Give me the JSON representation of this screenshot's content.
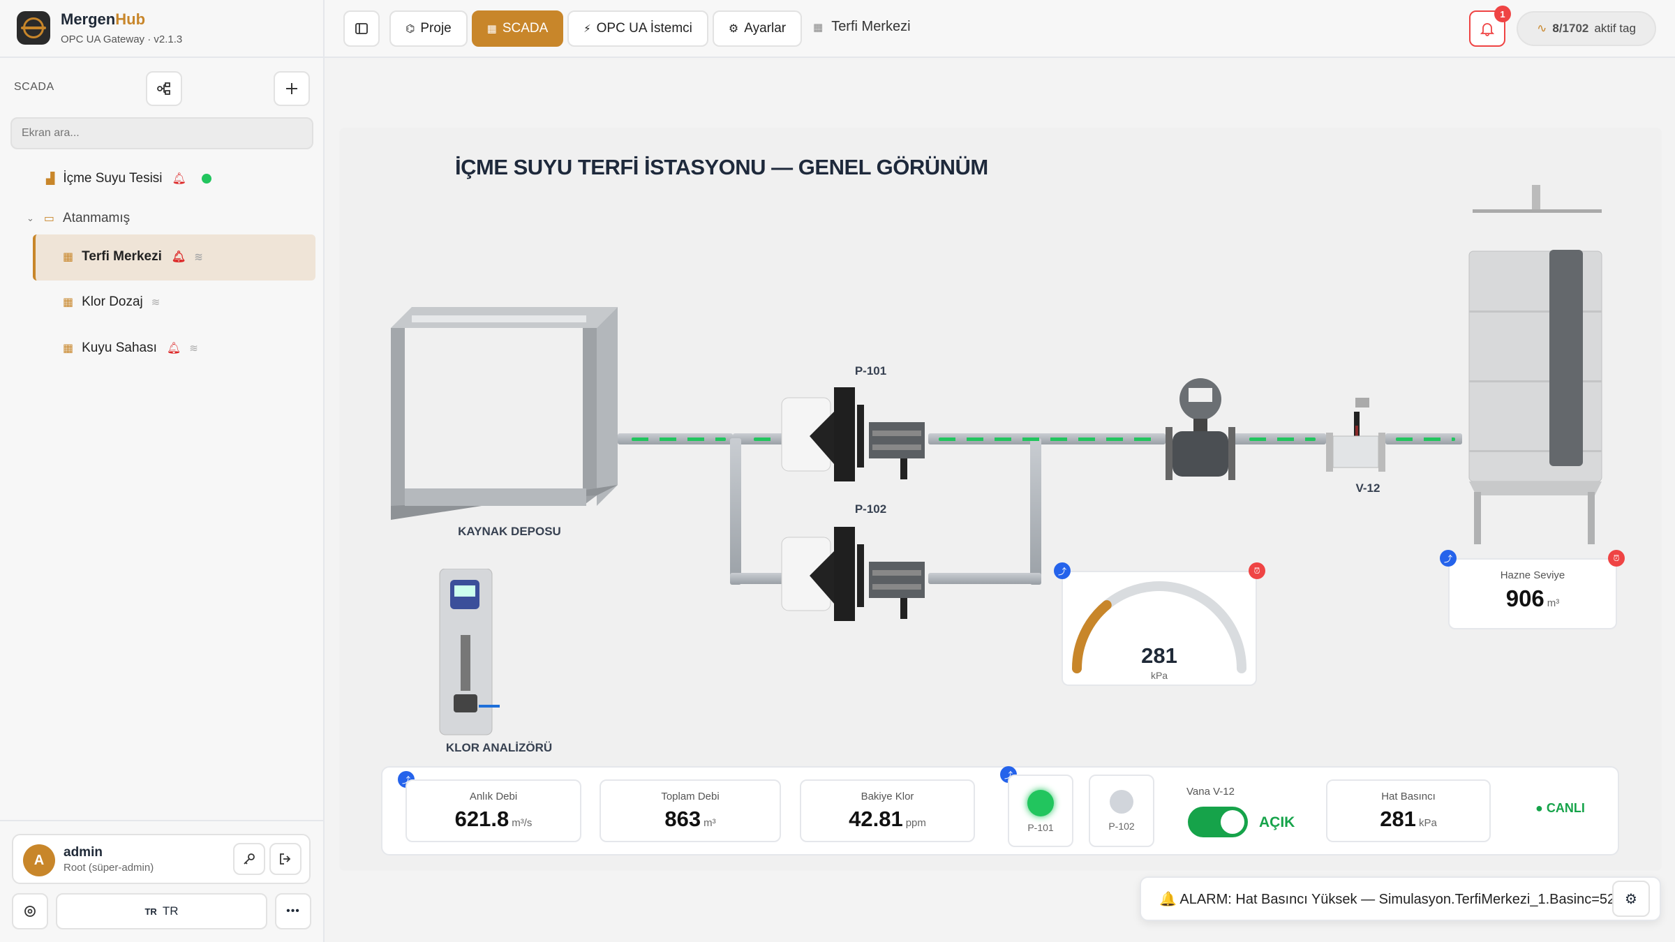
{
  "brand": {
    "name_main": "Mergen",
    "name_accent": "Hub",
    "subtitle": "OPC UA Gateway · v2.1.3"
  },
  "sidebar": {
    "heading": "SCADA",
    "search_placeholder": "Ekran ara...",
    "tree": {
      "plant": "İçme Suyu Tesisi",
      "group": "Atanmamış",
      "items": [
        {
          "label": "Terfi Merkezi"
        },
        {
          "label": "Klor Dozaj"
        },
        {
          "label": "Kuyu Sahası"
        }
      ]
    },
    "user": {
      "initial": "A",
      "name": "admin",
      "role": "Root (süper-admin)"
    },
    "language": {
      "code": "TR",
      "label": "TR"
    }
  },
  "topbar": {
    "tabs": [
      {
        "label": "Proje"
      },
      {
        "label": "SCADA"
      },
      {
        "label": "OPC UA İstemci"
      },
      {
        "label": "Ayarlar"
      }
    ],
    "breadcrumb": "Terfi Merkezi",
    "alarm_count": "1",
    "tags_active": "8",
    "tags_total": "/1702",
    "tags_suffix": "aktif tag"
  },
  "scada": {
    "title": "İÇME SUYU TERFİ İSTASYONU — GENEL GÖRÜNÜM",
    "source_tank": "KAYNAK DEPOSU",
    "pump1": "P-101",
    "pump2": "P-102",
    "valve": "V-12",
    "analyzer": "KLOR ANALİZÖRÜ",
    "gauge": {
      "value": "281",
      "unit": "kPa",
      "fraction": 0.28
    },
    "tank_level": {
      "title": "Hazne Seviye",
      "value": "906",
      "unit": "m³"
    }
  },
  "panel": {
    "flow": {
      "title": "Anlık Debi",
      "value": "621.8",
      "unit": "m³/s"
    },
    "total": {
      "title": "Toplam Debi",
      "value": "863",
      "unit": "m³"
    },
    "chlorine": {
      "title": "Bakiye Klor",
      "value": "42.81",
      "unit": "ppm"
    },
    "p101": "P-101",
    "p102": "P-102",
    "valve_title": "Vana V-12",
    "valve_state": "AÇIK",
    "pressure": {
      "title": "Hat Basıncı",
      "value": "281",
      "unit": "kPa"
    },
    "live": "● CANLI"
  },
  "toast": {
    "text": "🔔 ALARM: Hat Basıncı Yüksek — Simulasyon.TerfiMerkezi_1.Basinc=52"
  },
  "colors": {
    "accent": "#c8862a",
    "ok": "#22c55e",
    "alarm": "#ef4444",
    "info": "#2563eb"
  }
}
